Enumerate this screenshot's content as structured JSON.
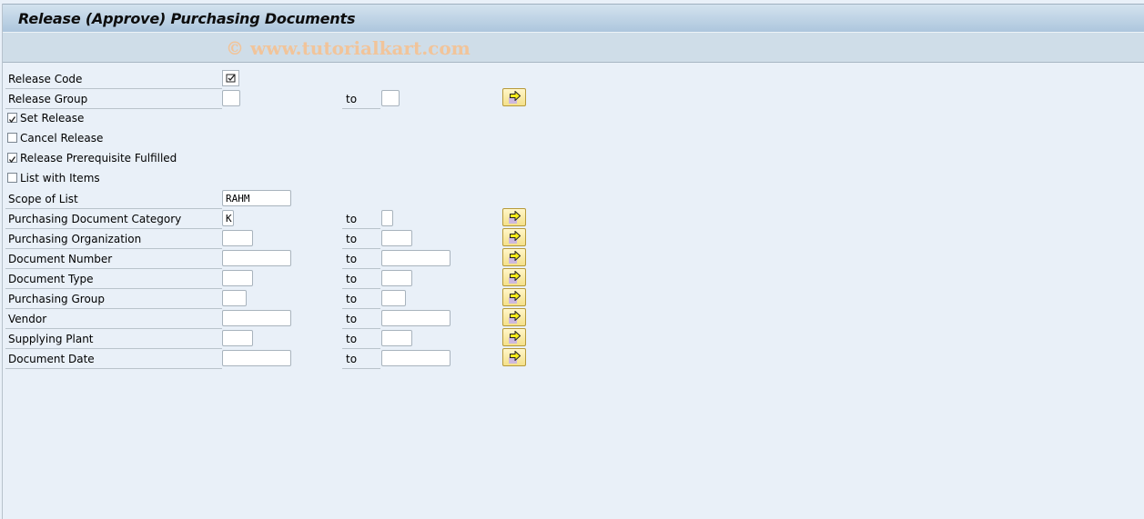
{
  "header": {
    "title": "Release (Approve) Purchasing Documents",
    "watermark": "© www.tutorialkart.com"
  },
  "form": {
    "release_code": {
      "label": "Release Code",
      "checked": true
    },
    "release_group": {
      "label": "Release Group",
      "from": "",
      "to": "",
      "to_label": "to"
    },
    "set_release": {
      "label": "Set Release",
      "checked": true
    },
    "cancel_release": {
      "label": "Cancel Release",
      "checked": false
    },
    "release_prereq": {
      "label": "Release Prerequisite Fulfilled",
      "checked": true
    },
    "list_with_items": {
      "label": "List with Items",
      "checked": false
    },
    "scope_of_list": {
      "label": "Scope of List",
      "value": "RAHM"
    },
    "ranges": [
      {
        "label": "Purchasing Document Category",
        "from": "K",
        "to": "",
        "to_label": "to"
      },
      {
        "label": "Purchasing Organization",
        "from": "",
        "to": "",
        "to_label": "to"
      },
      {
        "label": "Document Number",
        "from": "",
        "to": "",
        "to_label": "to"
      },
      {
        "label": "Document Type",
        "from": "",
        "to": "",
        "to_label": "to"
      },
      {
        "label": "Purchasing Group",
        "from": "",
        "to": "",
        "to_label": "to"
      },
      {
        "label": "Vendor",
        "from": "",
        "to": "",
        "to_label": "to"
      },
      {
        "label": "Supplying Plant",
        "from": "",
        "to": "",
        "to_label": "to"
      },
      {
        "label": "Document Date",
        "from": "",
        "to": "",
        "to_label": "to"
      }
    ]
  }
}
